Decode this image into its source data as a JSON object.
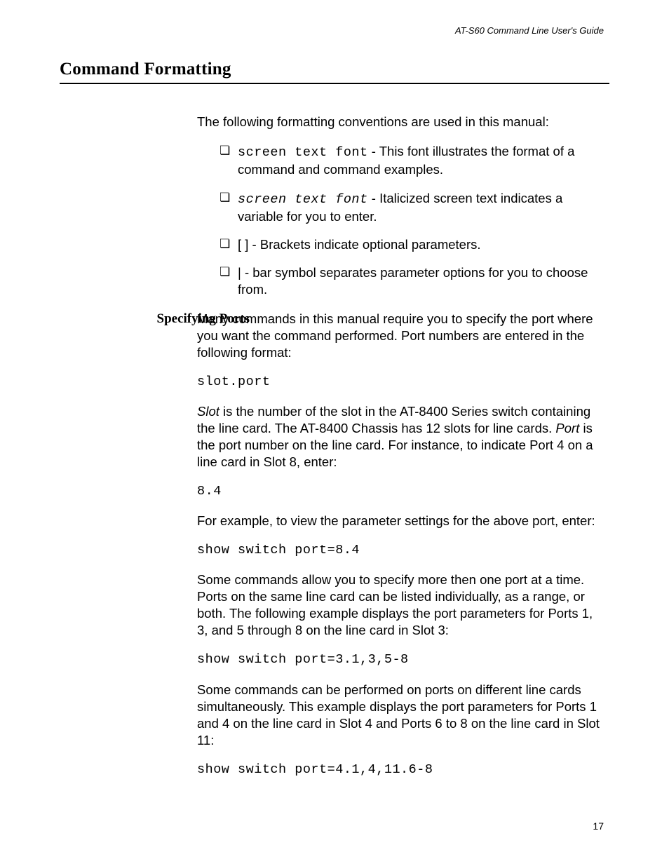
{
  "running_head": "AT-S60 Command Line User's Guide",
  "title": "Command Formatting",
  "intro": "The following formatting conventions are used in this manual:",
  "bullets": {
    "b1_code": "screen text font",
    "b1_rest": " - This font illustrates the format of a command and command examples.",
    "b2_code": "screen text font",
    "b2_rest": " - Italicized screen text indicates a variable for you to enter.",
    "b3": "[ ] - Brackets indicate optional parameters.",
    "b4": "| - bar symbol separates parameter options for you to choose from."
  },
  "side_heading": "Specifying Ports",
  "sp": {
    "p1": "Many commands in this manual require you to specify the port where you want the command performed. Port numbers are entered in the following format:",
    "code1": "slot.port",
    "p2_slot": "Slot",
    "p2_mid": " is the number of the slot in the AT-8400 Series switch containing the line card. The AT-8400 Chassis has 12 slots for line cards. ",
    "p2_port": "Port",
    "p2_end": " is the port number on the line card. For instance, to indicate Port 4 on a line card in Slot 8, enter:",
    "code2": "8.4",
    "p3": "For example, to view the parameter settings for the above port, enter:",
    "code3": "show switch port=8.4",
    "p4": "Some commands allow you to specify more then one port at a time. Ports on the same line card can be listed individually, as a range, or both. The following example displays the port parameters for Ports 1, 3, and 5 through 8 on the line card in Slot 3:",
    "code4": "show switch port=3.1,3,5-8",
    "p5": "Some commands can be performed on ports on different line cards simultaneously. This example displays the port parameters for Ports 1 and 4 on the line card in Slot 4 and Ports 6 to 8 on the line card in Slot 11:",
    "code5": "show switch port=4.1,4,11.6-8"
  },
  "page_number": "17"
}
